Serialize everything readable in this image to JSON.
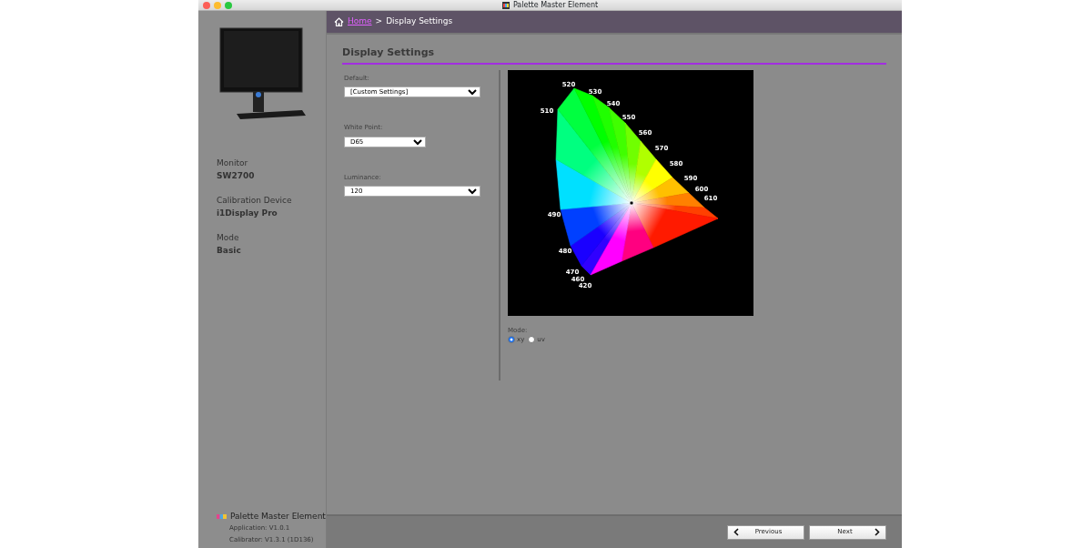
{
  "window": {
    "title": "Palette Master Element"
  },
  "sidebar": {
    "info": [
      {
        "label": "Monitor",
        "value": "SW2700"
      },
      {
        "label": "Calibration Device",
        "value": "i1Display Pro"
      },
      {
        "label": "Mode",
        "value": "Basic"
      }
    ],
    "app_name": "Palette Master Element",
    "versions": [
      "Application: V1.0.1",
      "Calibrator: V1.3.1 (1D136)"
    ]
  },
  "breadcrumb": {
    "home": "Home",
    "separator": ">",
    "current": "Display Settings"
  },
  "section_title": "Display Settings",
  "fields": [
    {
      "label": "Default:",
      "value": "[Custom Settings]"
    },
    {
      "label": "White Point:",
      "value": "D65"
    },
    {
      "label": "Luminance:",
      "value": "120"
    }
  ],
  "diagram": {
    "wavelength_labels": [
      "520",
      "530",
      "540",
      "550",
      "560",
      "570",
      "580",
      "590",
      "600",
      "610",
      "510",
      "490",
      "480",
      "470",
      "460",
      "420"
    ]
  },
  "mode": {
    "label": "Mode:",
    "options": [
      {
        "label": "xy",
        "selected": true
      },
      {
        "label": "uv",
        "selected": false
      }
    ]
  },
  "buttons": [
    {
      "label": "Previous",
      "kind": "back"
    },
    {
      "label": "Next",
      "kind": "forward"
    }
  ]
}
